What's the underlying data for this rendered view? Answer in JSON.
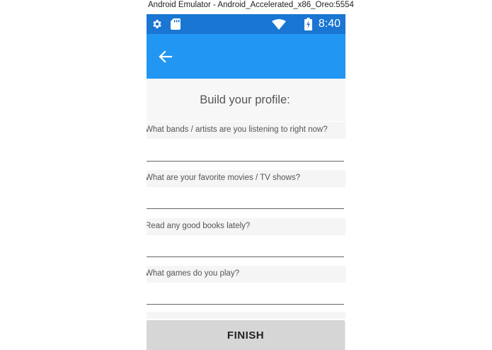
{
  "window": {
    "title": "Android Emulator - Android_Accelerated_x86_Oreo:5554"
  },
  "status_bar": {
    "time": "8:40",
    "icons": [
      "settings-icon",
      "sd-card-icon",
      "wifi-icon",
      "battery-icon"
    ],
    "color": "#1976d2"
  },
  "app_bar": {
    "back_icon": "arrow-left-icon",
    "color": "#2196f3"
  },
  "profile": {
    "title": "Build your profile:",
    "questions": [
      {
        "label": "What bands / artists are you listening to right now?",
        "value": ""
      },
      {
        "label": "What are your favorite movies / TV shows?",
        "value": ""
      },
      {
        "label": "Read any good books lately?",
        "value": ""
      },
      {
        "label": "What games do you play?",
        "value": ""
      }
    ],
    "finish_label": "FINISH"
  }
}
